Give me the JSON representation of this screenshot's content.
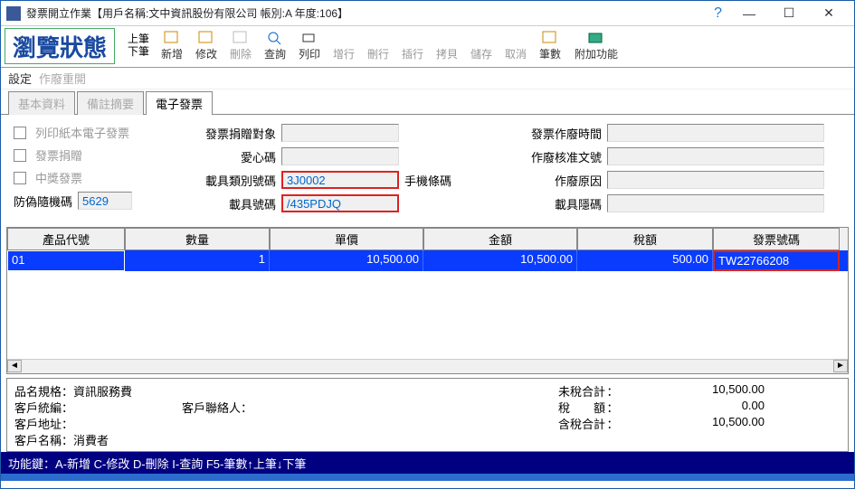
{
  "titlebar": {
    "title": "發票開立作業【用戶名稱:文中資訊股份有限公司  帳別:A  年度:106】"
  },
  "winbtns": {
    "min": "—",
    "max": "☐",
    "close": "✕"
  },
  "mode": "瀏覽狀態",
  "toolbar": {
    "prev": "上筆",
    "next": "下筆",
    "add": "新增",
    "edit": "修改",
    "del": "刪除",
    "query": "查詢",
    "print": "列印",
    "addrow": "增行",
    "delrow": "刪行",
    "insrow": "插行",
    "copy": "拷貝",
    "save": "儲存",
    "cancel": "取消",
    "count": "筆數",
    "extra": "附加功能"
  },
  "menu": {
    "settings": "設定",
    "reopen": "作廢重開"
  },
  "tabs": {
    "basic": "基本資料",
    "remark": "備註摘要",
    "einv": "電子發票"
  },
  "form": {
    "printPaper": "列印紙本電子發票",
    "donate": "發票捐贈",
    "prize": "中獎發票",
    "antiFakeLbl": "防偽隨機碼",
    "antiFakeVal": "5629",
    "donateTarget": "發票捐贈對象",
    "loveCode": "愛心碼",
    "carrierTypeLbl": "載具類別號碼",
    "carrierTypeVal": "3J0002",
    "carrierNoLbl": "載具號碼",
    "carrierNoVal": "/435PDJQ",
    "mobileBarcode": "手機條碼",
    "voidTime": "發票作廢時間",
    "voidApprove": "作廢核准文號",
    "voidReason": "作廢原因",
    "carrierHidden": "載具隱碼"
  },
  "grid": {
    "headers": [
      "產品代號",
      "數量",
      "單價",
      "金額",
      "稅額",
      "發票號碼"
    ],
    "row": {
      "prod": "01",
      "qty": "1",
      "price": "10,500.00",
      "amount": "10,500.00",
      "tax": "500.00",
      "inv": "TW22766208"
    }
  },
  "summary": {
    "specLbl": "品名規格：",
    "specVal": "資訊服務費",
    "custCodeLbl": "客戶統編：",
    "contactLbl": "客戶聯絡人：",
    "custAddrLbl": "客戶地址：",
    "custNameLbl": "客戶名稱：",
    "custNameVal": "消費者",
    "subtotalLbl": "未稅合計",
    "subtotalVal": "10,500.00",
    "taxLbl": "稅　　額",
    "taxVal": "0.00",
    "totalLbl": "含稅合計",
    "totalVal": "10,500.00"
  },
  "status": "功能鍵：A-新增 C-修改 D-刪除 I-查詢 F5-筆數↑上筆↓下筆"
}
